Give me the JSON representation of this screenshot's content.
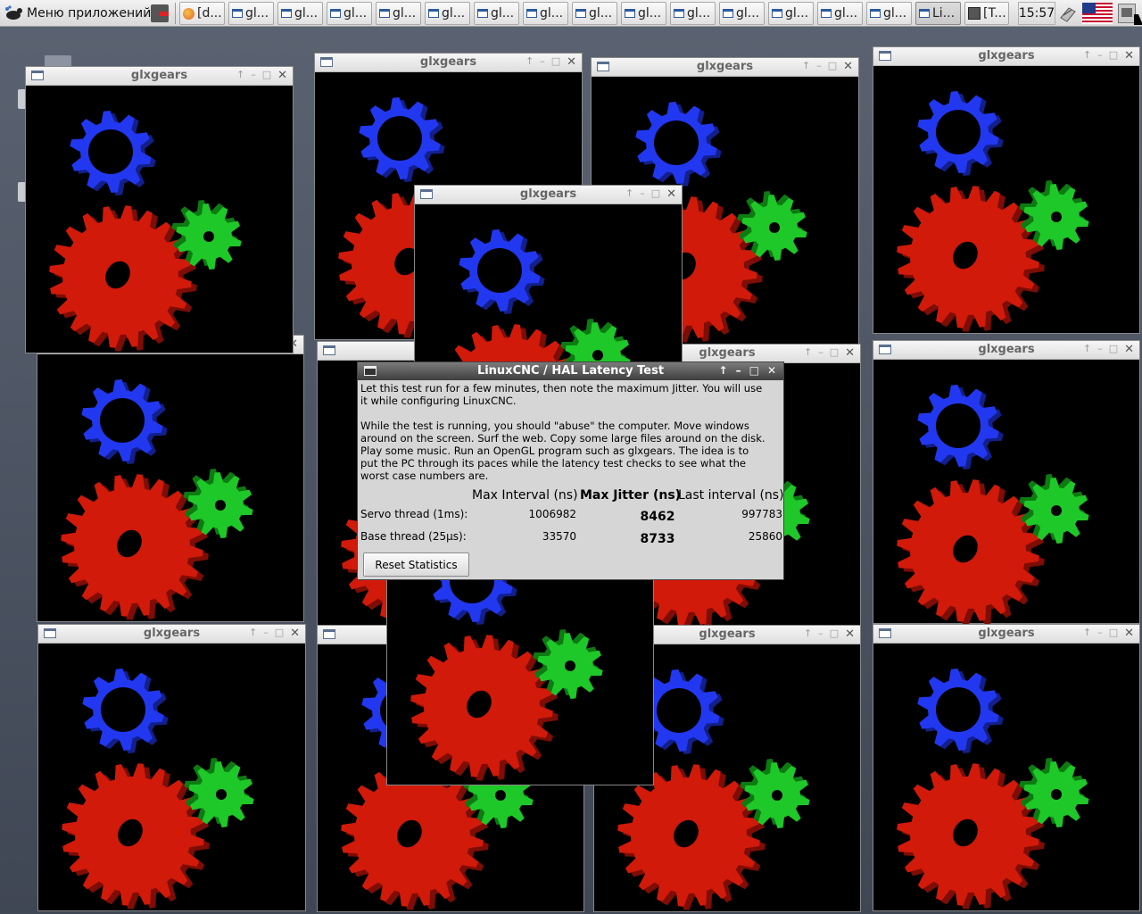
{
  "taskbar": {
    "menu_label": "Меню приложений",
    "tasks": [
      "[d...",
      "gl...",
      "gl...",
      "gl...",
      "gl...",
      "gl...",
      "gl...",
      "gl...",
      "gl...",
      "gl...",
      "gl...",
      "gl...",
      "gl...",
      "gl...",
      "gl...",
      "Li...",
      "[T..."
    ],
    "active_task_index": 15,
    "clock": "15:57",
    "keyboard_layout": "us-flag-icon"
  },
  "glx_window_title": "glxgears",
  "gear_colors": {
    "big": "#d11a0a",
    "small_top": "#2238f0",
    "small_right": "#1ec828"
  },
  "dialog": {
    "title": "LinuxCNC / HAL Latency Test",
    "message": "Let this test run for a few minutes, then note the maximum Jitter. You will use\nit while configuring LinuxCNC.\n\nWhile the test is running, you should \"abuse\" the computer. Move windows\naround on the screen. Surf the web. Copy some large files around on the disk.\nPlay some music. Run an OpenGL program such as glxgears. The idea is to\nput the PC through its paces while the latency test checks to see what the\nworst case numbers are.",
    "columns": {
      "max_interval": "Max Interval (ns)",
      "max_jitter": "Max Jitter (ns)",
      "last_interval": "Last interval (ns)"
    },
    "rows": [
      {
        "label": "Servo thread (1ms):",
        "max_interval": "1006982",
        "max_jitter": "8462",
        "last_interval": "997783"
      },
      {
        "label": "Base thread (25µs):",
        "max_interval": "33570",
        "max_jitter": "8733",
        "last_interval": "25860"
      }
    ],
    "reset_button": "Reset Statistics"
  }
}
